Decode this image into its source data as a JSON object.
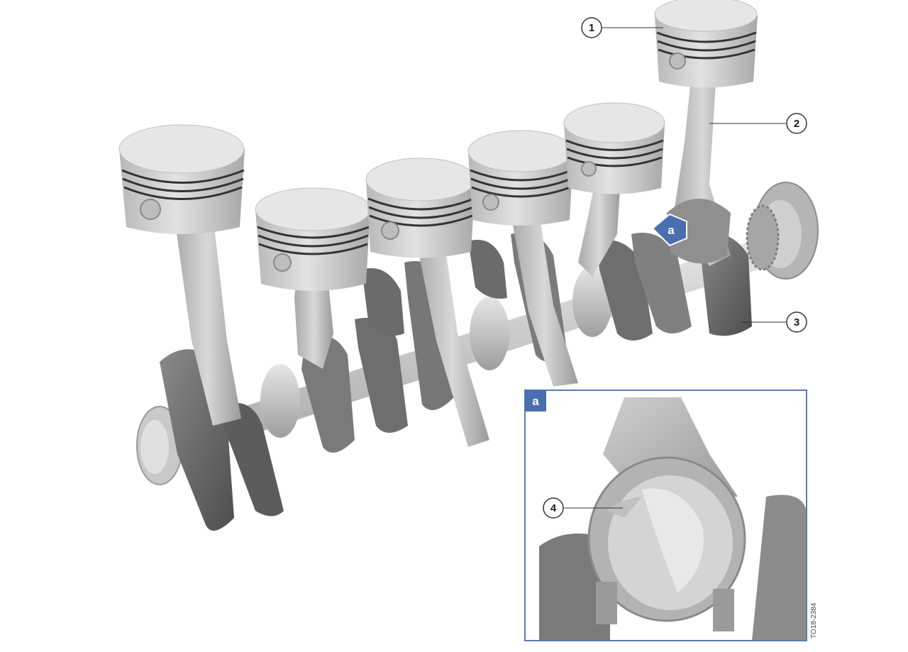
{
  "diagram": {
    "callouts": {
      "c1": "1",
      "c2": "2",
      "c3": "3",
      "c4": "4"
    },
    "detail_marker": "a",
    "inset_tag": "a",
    "figure_code": "TO18-2384"
  },
  "colors": {
    "piston": "#d6d6d6",
    "piston_top": "#e4e4e4",
    "ring": "#3a3a3a",
    "rod": "#c4c4c4",
    "counterweight": "#6a6a6a",
    "journal": "#d0d0d0",
    "accent_blue": "#4a6fb0",
    "inset_border": "#5a7ab8"
  }
}
